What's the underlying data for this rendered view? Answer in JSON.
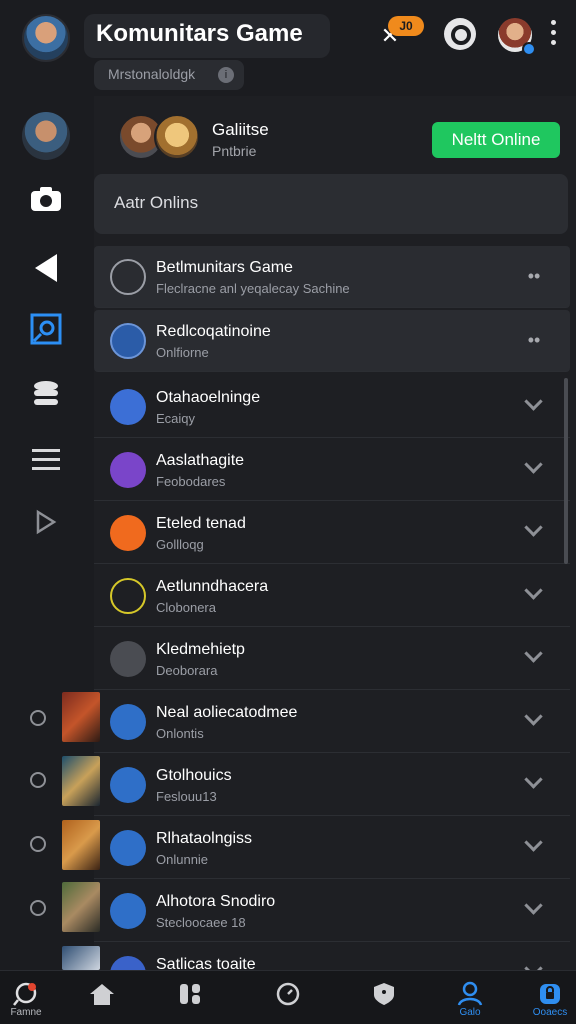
{
  "header": {
    "title": "Komunitars Game",
    "subtitle": "Mrstonaloldgk",
    "badge": "J0",
    "icons": [
      "tools-icon",
      "search-icon",
      "more-vertical-icon"
    ]
  },
  "sidebar": {
    "icons": [
      "camera-icon",
      "back-triangle-icon",
      "square-speech-icon",
      "stack-icon",
      "menu-icon",
      "play-icon"
    ]
  },
  "online": {
    "name": "Galiitse",
    "sub": "Pntbrie",
    "button": "Neltt Online",
    "status": "Aatr Onlins"
  },
  "list": [
    {
      "name": "Betlmunitars Game",
      "sub": "Fleclracne anl yeqalecay Sachine",
      "action": "more",
      "color": "#3b3d43"
    },
    {
      "name": "Redlcoqatinoine",
      "sub": "Onlfiorne",
      "action": "more",
      "color": "#2b5ca8"
    },
    {
      "name": "Otahaoelninge",
      "sub": "Ecaiqy",
      "action": "chevron",
      "color": "#3c6fd6"
    },
    {
      "name": "Aaslathagite",
      "sub": "Feobodares",
      "action": "chevron",
      "color": "#7a45c9"
    },
    {
      "name": "Eteled tenad",
      "sub": "Gollloqg",
      "action": "chevron",
      "color": "#f06a1e"
    },
    {
      "name": "Aetlunndhacera",
      "sub": "Clobonera",
      "action": "chevron",
      "color": "#d6c829"
    },
    {
      "name": "Kledmehietp",
      "sub": "Deoborara",
      "action": "chevron",
      "color": "#4a4c52"
    },
    {
      "name": "Neal aoliecatodmee",
      "sub": "Onlontis",
      "action": "chevron",
      "color": "#2f6fc8"
    },
    {
      "name": "Gtolhouics",
      "sub": "Feslouu13",
      "action": "chevron",
      "color": "#2f6fc8"
    },
    {
      "name": "Rlhataolngiss",
      "sub": "Onlunnie",
      "action": "chevron",
      "color": "#2f6fc8"
    },
    {
      "name": "Alhotora Snodiro",
      "sub": "Stecloocaee 18",
      "action": "chevron",
      "color": "#2f6fc8"
    },
    {
      "name": "Satlicas toaite",
      "sub": "",
      "action": "chevron",
      "color": "#3a62c9"
    }
  ],
  "bottom_nav": [
    {
      "label": "Famne",
      "icon": "chat-bubble-icon"
    },
    {
      "label": "",
      "icon": "home-icon"
    },
    {
      "label": "",
      "icon": "grid-icon"
    },
    {
      "label": "",
      "icon": "compass-icon"
    },
    {
      "label": "",
      "icon": "shield-icon"
    },
    {
      "label": "Galo",
      "icon": "user-icon"
    },
    {
      "label": "Ooaecs",
      "icon": "lock-icon"
    }
  ]
}
